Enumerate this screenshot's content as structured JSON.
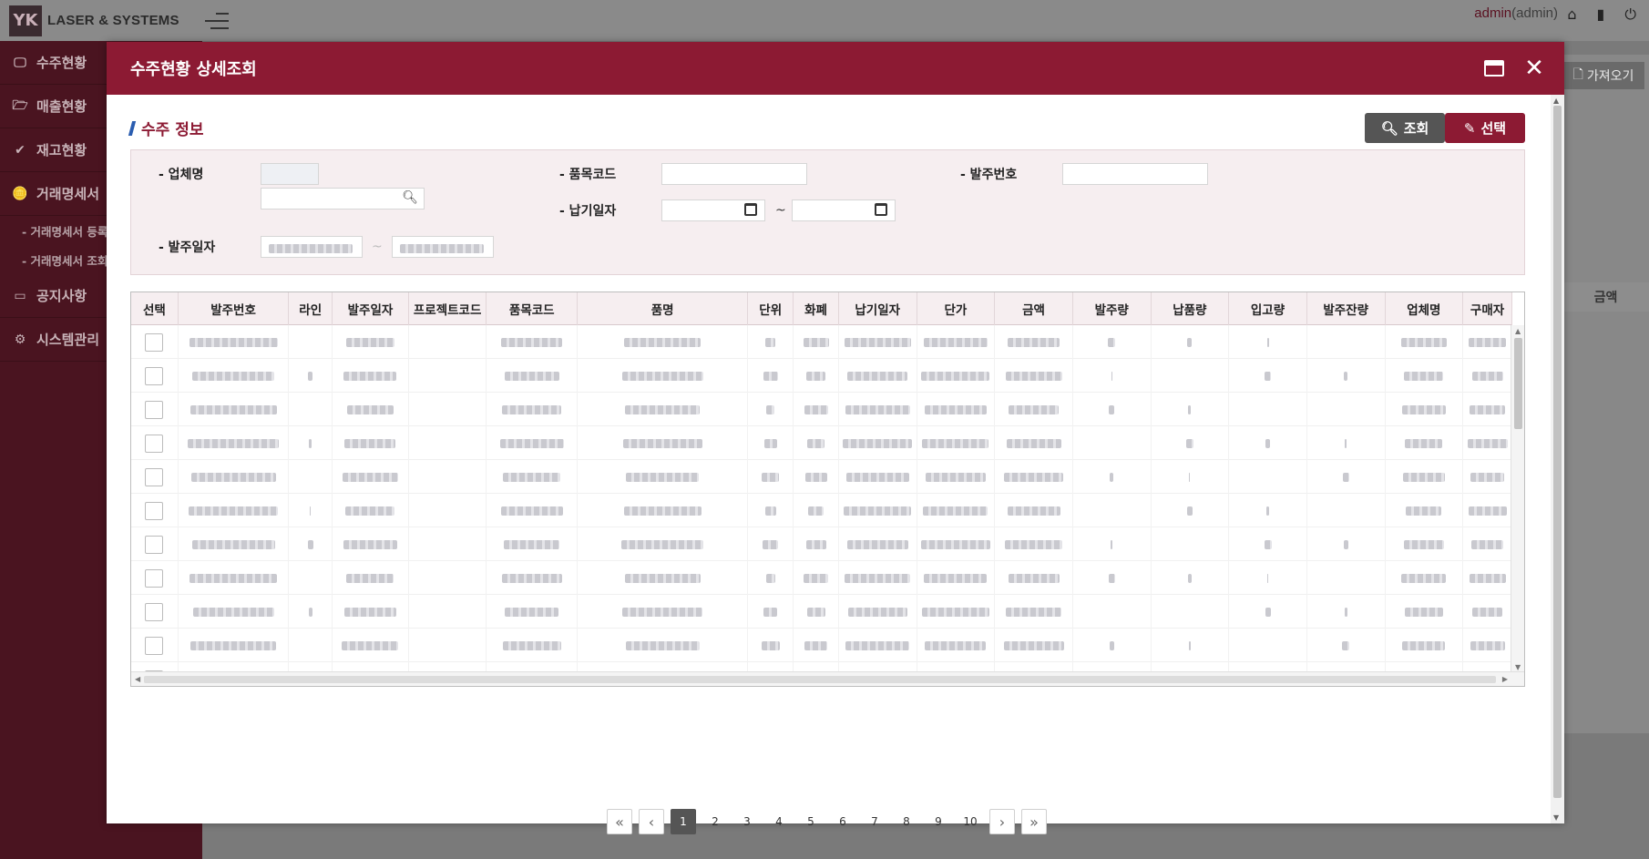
{
  "app": {
    "brand": "LASER & SYSTEMS",
    "logo_text": "YK",
    "user_name": "admin",
    "user_role": "(admin)"
  },
  "sidebar": {
    "items": [
      {
        "label": "수주현황",
        "icon": "monitor-icon",
        "glyph": "🖵"
      },
      {
        "label": "매출현황",
        "icon": "folder-icon",
        "glyph": "🗁"
      },
      {
        "label": "재고현황",
        "icon": "check-circle-icon",
        "glyph": "✔"
      },
      {
        "label": "거래명세서",
        "icon": "coins-icon",
        "glyph": "🪙"
      },
      {
        "label": "공지사항",
        "icon": "board-icon",
        "glyph": "▭"
      },
      {
        "label": "시스템관리",
        "icon": "gear-icon",
        "glyph": "⚙"
      }
    ],
    "subitems": [
      "- 거래명세서 등록",
      "- 거래명세서 조회"
    ]
  },
  "background": {
    "get_button": "가져오기",
    "amount_column": "금액"
  },
  "modal": {
    "title": "수주현황 상세조회",
    "section_title": "수주 정보",
    "search_button": "조회",
    "select_button": "선택",
    "filters": {
      "company_label": "- 업체명",
      "item_code_label": "- 품목코드",
      "order_no_label": "- 발주번호",
      "delivery_date_label": "- 납기일자",
      "order_date_label": "- 발주일자",
      "range_separator": "~",
      "date_range_separator": "~"
    },
    "grid": {
      "columns": [
        "선택",
        "발주번호",
        "라인",
        "발주일자",
        "프로젝트코드",
        "품목코드",
        "품명",
        "단위",
        "화폐",
        "납기일자",
        "단가",
        "금액",
        "발주량",
        "납품량",
        "입고량",
        "발주잔량",
        "업체명",
        "구매자"
      ],
      "row_count": 12
    },
    "pagination": {
      "pages": [
        "1",
        "2",
        "3",
        "4",
        "5",
        "6",
        "7",
        "8",
        "9",
        "10"
      ],
      "current": "1"
    }
  },
  "colors": {
    "brand": "#8c1a33",
    "sidebar_bg": "#4a1420",
    "filter_bg": "#f6eef0"
  }
}
